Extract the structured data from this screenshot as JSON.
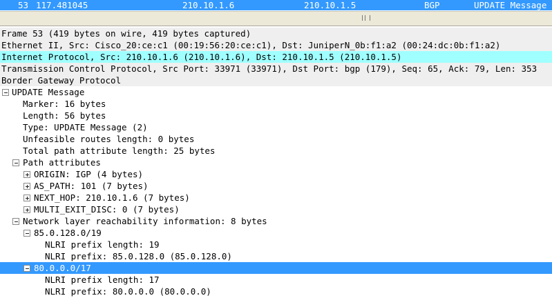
{
  "packet_list": {
    "selected_row": {
      "no": "53",
      "time": "117.481045",
      "source": "210.10.1.6",
      "destination": "210.10.1.5",
      "protocol": "BGP",
      "info": "UPDATE Message"
    }
  },
  "details": {
    "frame": "Frame 53 (419 bytes on wire, 419 bytes captured)",
    "ethernet": "Ethernet II, Src: Cisco_20:ce:c1 (00:19:56:20:ce:c1), Dst: JuniperN_0b:f1:a2 (00:24:dc:0b:f1:a2)",
    "ip": "Internet Protocol, Src: 210.10.1.6 (210.10.1.6), Dst: 210.10.1.5 (210.10.1.5)",
    "tcp": "Transmission Control Protocol, Src Port: 33971 (33971), Dst Port: bgp (179), Seq: 65, Ack: 79, Len: 353",
    "bgp": "Border Gateway Protocol",
    "update": "UPDATE Message",
    "marker": "Marker: 16 bytes",
    "length": "Length: 56 bytes",
    "type": "Type: UPDATE Message (2)",
    "unfeasible": "Unfeasible routes length: 0 bytes",
    "total_path": "Total path attribute length: 25 bytes",
    "path_attributes": "Path attributes",
    "origin": "ORIGIN: IGP (4 bytes)",
    "as_path": "AS_PATH: 101 (7 bytes)",
    "next_hop": "NEXT_HOP: 210.10.1.6 (7 bytes)",
    "med": "MULTI_EXIT_DISC: 0 (7 bytes)",
    "nlri": "Network layer reachability information: 8 bytes",
    "prefix1": "85.0.128.0/19",
    "prefix1_len": "NLRI prefix length: 19",
    "prefix1_val": "NLRI prefix: 85.0.128.0 (85.0.128.0)",
    "prefix2": "80.0.0.0/17",
    "prefix2_len": "NLRI prefix length: 17",
    "prefix2_val": "NLRI prefix: 80.0.0.0 (80.0.0.0)"
  },
  "icons": {
    "expanded": "minus-box-icon",
    "collapsed": "plus-box-icon"
  },
  "colors": {
    "selection": "#3399ff",
    "ip_highlight": "#a0ffff",
    "layer_gray": "#efefef"
  }
}
